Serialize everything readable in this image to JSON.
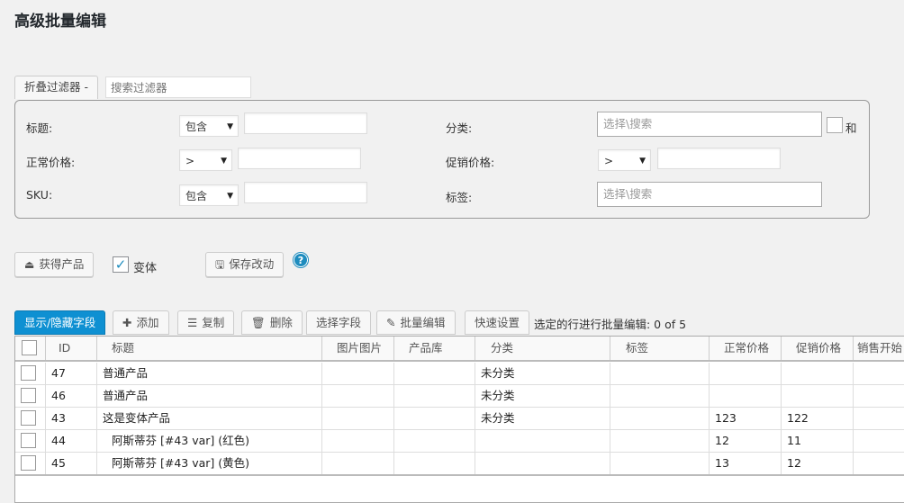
{
  "page": {
    "title": "高级批量编辑"
  },
  "filters": {
    "collapse_label": "折叠过滤器 -",
    "search_placeholder": "搜索过滤器",
    "title_label": "标题:",
    "title_op": "包含",
    "regular_price_label": "正常价格:",
    "regular_price_op": ">",
    "sku_label": "SKU:",
    "sku_op": "包含",
    "category_label": "分类:",
    "category_placeholder": "选择\\搜索",
    "and_label": "和",
    "sale_price_label": "促销价格:",
    "sale_price_op": ">",
    "tag_label": "标签:",
    "tag_placeholder": "选择\\搜索"
  },
  "actions": {
    "get_products": "获得产品",
    "variants_label": "变体",
    "variants_checked": true,
    "save_changes": "保存改动",
    "help": "?"
  },
  "toolbar": {
    "show_hide_fields": "显示/隐藏字段",
    "add": "添加",
    "duplicate": "复制",
    "delete": "删除",
    "select_fields": "选择字段",
    "bulk_edit": "批量编辑",
    "quick_settings": "快速设置",
    "status": "选定的行进行批量编辑: 0 of 5"
  },
  "table": {
    "columns": [
      "ID",
      "标题",
      "图片图片",
      "产品库",
      "分类",
      "标签",
      "正常价格",
      "促销价格",
      "销售开始"
    ],
    "rows": [
      {
        "id": "47",
        "title": "普通产品",
        "category": "未分类",
        "regular": "",
        "sale": ""
      },
      {
        "id": "46",
        "title": "普通产品",
        "category": "未分类",
        "regular": "",
        "sale": ""
      },
      {
        "id": "43",
        "title": "这是变体产品",
        "category": "未分类",
        "regular": "123",
        "sale": "122"
      },
      {
        "id": "44",
        "title": "阿斯蒂芬 [#43 var] (红色)",
        "category": "",
        "regular": "12",
        "sale": "11"
      },
      {
        "id": "45",
        "title": "阿斯蒂芬 [#43 var] (黄色)",
        "category": "",
        "regular": "13",
        "sale": "12"
      }
    ]
  },
  "colors": {
    "primary": "#0e90d2",
    "check": "#1e8cbe"
  }
}
